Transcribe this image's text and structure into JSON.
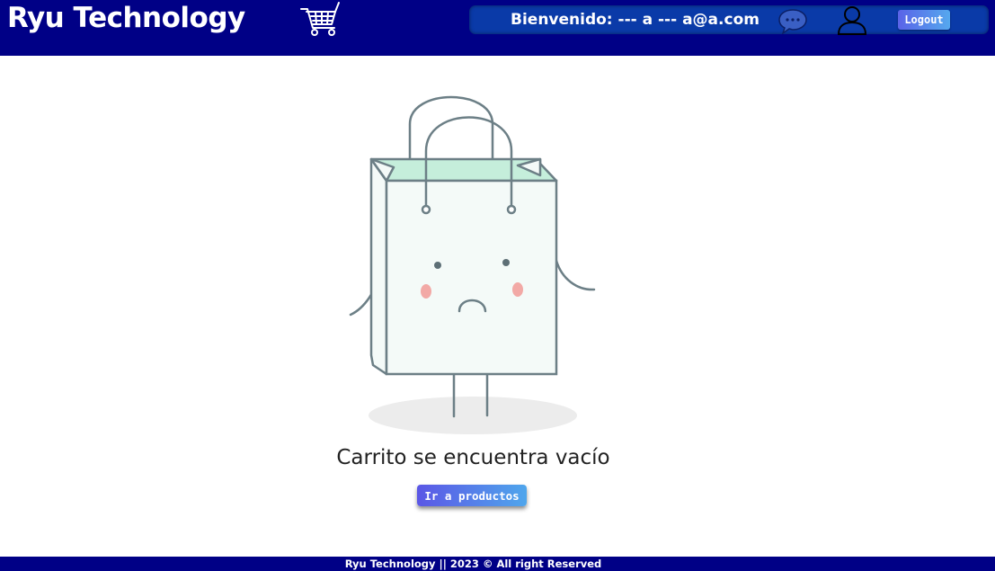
{
  "header": {
    "brand": "Ryu Technology",
    "cart_icon": "shopping-cart-icon",
    "welcome_text": "Bienvenido: --- a --- a@a.com",
    "chat_icon": "chat-bubble-icon",
    "user_icon": "user-profile-icon",
    "logout_label": "Logout"
  },
  "main": {
    "illustration": "sad-shopping-bag",
    "empty_message": "Carrito se encuentra vacío",
    "go_products_label": "Ir a productos"
  },
  "footer": {
    "text": "Ryu Technology || 2023 © All right Reserved"
  },
  "colors": {
    "navbar": "#000086",
    "userbar": "#0a3aa8",
    "button_gradient_start": "#5b57e6",
    "button_gradient_end": "#4fa6ec"
  }
}
